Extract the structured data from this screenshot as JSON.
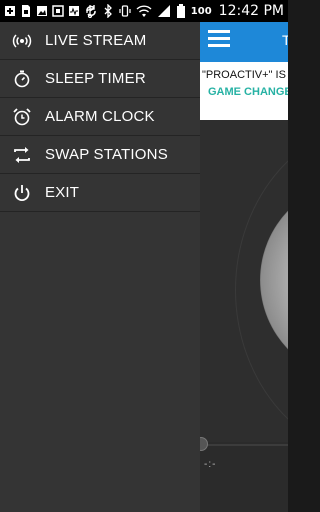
{
  "status_bar": {
    "left_icons": [
      "add-icon",
      "sim-icon",
      "image-icon",
      "app-icon",
      "pulse-icon",
      "usb-icon"
    ],
    "right_icons": [
      "sync-icon",
      "bluetooth-icon",
      "vibrate-icon",
      "wifi-icon",
      "signal-icon"
    ],
    "battery_percent": "100",
    "clock": "12:42",
    "clock_suffix": "PM"
  },
  "drawer": {
    "items": [
      {
        "label": "LIVE STREAM",
        "icon": "live-stream-icon"
      },
      {
        "label": "SLEEP TIMER",
        "icon": "stopwatch-icon"
      },
      {
        "label": "ALARM CLOCK",
        "icon": "alarm-clock-icon"
      },
      {
        "label": "SWAP STATIONS",
        "icon": "swap-icon"
      },
      {
        "label": "EXIT",
        "icon": "power-icon"
      }
    ]
  },
  "app": {
    "header_partial_title": "T",
    "ticker_line1": "\"PROACTIV+\" IS A",
    "ticker_line2": "GAME CHANGER",
    "time_display": "-:-",
    "colors": {
      "header": "#1e88d8",
      "ticker_accent": "#27b2a4",
      "drawer_bg": "#343434"
    }
  }
}
